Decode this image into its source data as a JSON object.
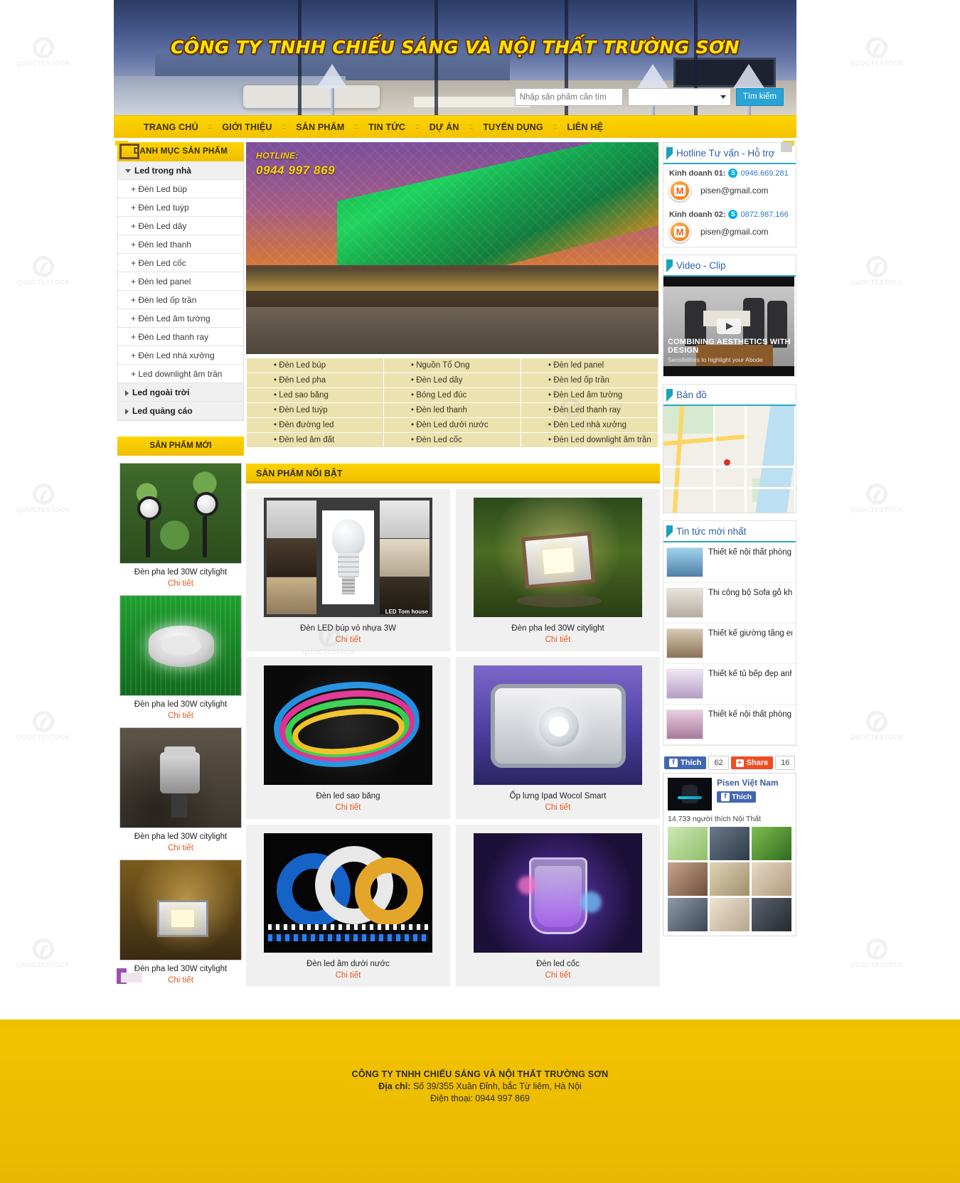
{
  "header": {
    "title": "CÔNG TY TNHH CHIẾU SÁNG VÀ NỘI THẤT TRƯỜNG SƠN",
    "search_placeholder": "Nhập sản phẩm cần tìm",
    "search_value": "",
    "search_category_selected": "",
    "search_button": "Tìm kiếm"
  },
  "nav": {
    "items": [
      {
        "label": "TRANG CHỦ"
      },
      {
        "label": "GIỚI THIỆU"
      },
      {
        "label": "SẢN PHẨM"
      },
      {
        "label": "TIN TỨC"
      },
      {
        "label": "DỰ ÁN"
      },
      {
        "label": "TUYỂN DỤNG"
      },
      {
        "label": "LIÊN HỆ"
      }
    ],
    "separator": "::"
  },
  "sidebar": {
    "category_head": "DANH MỤC SẢN PHẨM",
    "items": [
      {
        "label": "Led trong nhà",
        "type": "parent-open"
      },
      {
        "label": "+ Đèn Led búp",
        "type": "child"
      },
      {
        "label": "+ Đèn Led tuýp",
        "type": "child"
      },
      {
        "label": "+ Đèn Led dây",
        "type": "child"
      },
      {
        "label": "+ Đèn led thanh",
        "type": "child"
      },
      {
        "label": "+ Đèn Led cốc",
        "type": "child"
      },
      {
        "label": "+ Đèn led panel",
        "type": "child"
      },
      {
        "label": "+ Đèn led ốp trần",
        "type": "child"
      },
      {
        "label": "+ Đèn Led âm tường",
        "type": "child"
      },
      {
        "label": "+ Đèn Led thanh ray",
        "type": "child"
      },
      {
        "label": "+ Đèn Led nhà xưởng",
        "type": "child"
      },
      {
        "label": "+ Led downlight âm trần",
        "type": "child"
      },
      {
        "label": "Led ngoài trời",
        "type": "parent"
      },
      {
        "label": "Led quảng cáo",
        "type": "parent"
      }
    ],
    "new_products_head": "SẢN PHẨM MỚI",
    "new_products": [
      {
        "name": "Đèn pha led 30W citylight",
        "detail": "Chi tiết",
        "theme": "garden-spot"
      },
      {
        "name": "Đèn pha led 30W citylight",
        "detail": "Chi tiết",
        "theme": "green-round"
      },
      {
        "name": "Đèn pha led 30W citylight",
        "detail": "Chi tiết",
        "theme": "underwater"
      },
      {
        "name": "Đèn pha led 30W citylight",
        "detail": "Chi tiết",
        "theme": "floodlight"
      }
    ]
  },
  "hero": {
    "hotline_label": "HOTLINE:",
    "hotline_number": "0944 997 869"
  },
  "category_table": {
    "rows": [
      [
        "Đèn Led búp",
        "Nguồn Tổ Ong",
        "Đèn led panel"
      ],
      [
        "Đèn Led pha",
        "Đèn Led dây",
        "Đèn led ốp trần"
      ],
      [
        "Led sao băng",
        "Bóng Led đúc",
        "Đèn Led âm tường"
      ],
      [
        "Đèn Led tuýp",
        "Đèn led thanh",
        "Đèn Led thanh ray"
      ],
      [
        "Đèn đường led",
        "Đèn Led dưới nước",
        "Đèn Led nhà xưởng"
      ],
      [
        "Đèn led âm đất",
        "Đèn Led cốc",
        "Đèn Led downlight âm trần"
      ]
    ]
  },
  "featured": {
    "head": "SẢN PHẨM NỔI BẬT",
    "products": [
      {
        "name": "Đèn LED búp vỏ nhựa 3W",
        "detail": "Chi tiết",
        "theme": "bulb-collage",
        "caption": "LED Tom house"
      },
      {
        "name": "Đèn pha led 30W citylight",
        "detail": "Chi tiết",
        "theme": "garden-flood"
      },
      {
        "name": "Đèn led sao băng",
        "detail": "Chi tiết",
        "theme": "rgb-strip"
      },
      {
        "name": "Ốp lưng Ipad Wocol Smart",
        "detail": "Chi tiết",
        "theme": "big-flood"
      },
      {
        "name": "Đèn led âm dưới nước",
        "detail": "Chi tiết",
        "theme": "strip-reels"
      },
      {
        "name": "Đèn led cốc",
        "detail": "Chi tiết",
        "theme": "led-cup"
      }
    ]
  },
  "right": {
    "hotline_head": "Hotline Tư vấn - Hỗ trợ",
    "contacts": [
      {
        "label": "Kinh doanh 01:",
        "phone": "0946.669.281",
        "email": "pisen@gmail.com"
      },
      {
        "label": "Kinh doanh 02:",
        "phone": "0872.987.166",
        "email": "pisen@gmail.com"
      }
    ],
    "video_head": "Video - Clip",
    "video_title": "COMBINING AESTHETICS WITH DESIGN",
    "video_sub": "Sensibilities to highlight your Abode",
    "map_head": "Bản đồ",
    "news_head": "Tin tức mới nhất",
    "news": [
      {
        "title": "Thiết kế nội thất phòng trẻ em - Linh Đàm"
      },
      {
        "title": "Thi công bộ Sofa gỗ khách"
      },
      {
        "title": "Thiết kế giường tầng em"
      },
      {
        "title": "Thiết kế tủ bếp đẹp anh Kiên"
      },
      {
        "title": "Thiết kế nội thất phòng trẻ em"
      }
    ],
    "fb_like_label": "Thích",
    "fb_like_count": "62",
    "fb_share_label": "Share",
    "fb_share_count": "16",
    "fb_page_name": "Pisen Việt Nam",
    "fb_page_like": "Thích",
    "fb_page_count": "14.733 người thích Nội Thất"
  },
  "footer": {
    "company": "CÔNG TY TNHH CHIẾU SÁNG VÀ NỘI THẤT TRƯỜNG SƠN",
    "address_label": "Địa chỉ:",
    "address": "Số 39/355 Xuân Đỉnh, bắc Từ liêm, Hà Nội",
    "phone_label": "Điện thoại:",
    "phone": "0944 997 869"
  },
  "colors": {
    "brand_yellow": "#ffd400",
    "accent_orange": "#e8571e",
    "link_blue": "#2f79c7",
    "title_yellow": "#ffe500"
  }
}
